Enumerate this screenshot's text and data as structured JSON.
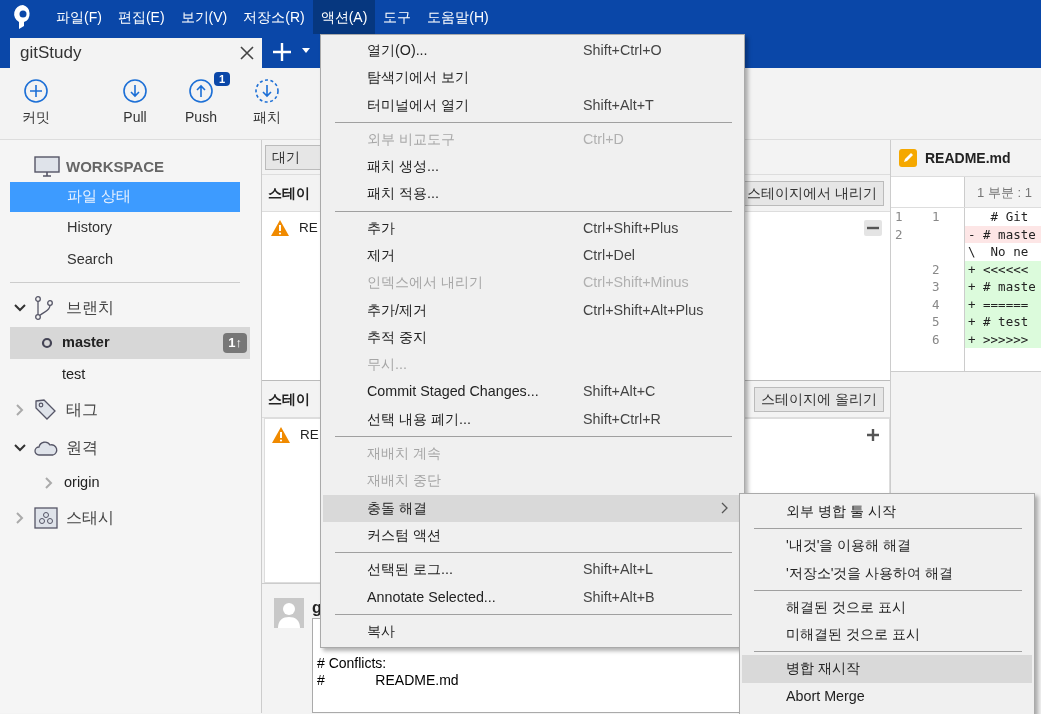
{
  "menubar": [
    {
      "label": "파일(F)",
      "selected": false
    },
    {
      "label": "편집(E)",
      "selected": false
    },
    {
      "label": "보기(V)",
      "selected": false
    },
    {
      "label": "저장소(R)",
      "selected": false
    },
    {
      "label": "액션(A)",
      "selected": true
    },
    {
      "label": "도구",
      "selected": false
    },
    {
      "label": "도움말(H)",
      "selected": false
    }
  ],
  "tabs": [
    {
      "label": "gitStudy",
      "selected": true
    }
  ],
  "toolbar": [
    {
      "label": "커밋",
      "kind": "commit"
    },
    {
      "label": "Pull",
      "kind": "pull"
    },
    {
      "label": "Push",
      "kind": "push",
      "badge": "1"
    },
    {
      "label": "패치",
      "kind": "patch"
    }
  ],
  "sidebar": {
    "workspace": {
      "title": "WORKSPACE",
      "items": [
        {
          "label": "파일 상태",
          "selected": true
        },
        {
          "label": "History",
          "selected": false
        },
        {
          "label": "Search",
          "selected": false
        }
      ]
    },
    "groups": [
      {
        "label": "브랜치",
        "kind": "branch",
        "expanded": true,
        "children": [
          {
            "label": "master",
            "current": true,
            "selected": true,
            "badge": "1↑"
          },
          {
            "label": "test",
            "current": false,
            "selected": false
          }
        ]
      },
      {
        "label": "태그",
        "kind": "tag",
        "expanded": false
      },
      {
        "label": "원격",
        "kind": "remote",
        "expanded": true,
        "children": [
          {
            "label": "origin",
            "expanded": false,
            "selected": false
          }
        ]
      },
      {
        "label": "스태시",
        "kind": "stash",
        "expanded": false
      }
    ]
  },
  "files": {
    "pending_button": "대기",
    "staged": {
      "title": "스테이",
      "button": "스테이지에서 내리기",
      "rows": [
        {
          "name": "RE"
        }
      ]
    },
    "unstaged": {
      "title": "스테이",
      "button": "스테이지에 올리기",
      "rows": [
        {
          "name": "RE"
        }
      ]
    }
  },
  "commit": {
    "author": "g",
    "message": "# Conflicts:\n#\tREADME.md"
  },
  "diff": {
    "file": "README.md",
    "hunk": "1 부분 : 1",
    "lines": [
      {
        "old": "1",
        "new": "1",
        "text": "   # Git",
        "kind": "context"
      },
      {
        "old": "2",
        "text": "- # maste",
        "kind": "removed"
      },
      {
        "text": "\\  No ne",
        "kind": "context"
      },
      {
        "new": "2",
        "text": "+ <<<<<<",
        "kind": "added"
      },
      {
        "new": "3",
        "text": "+ # maste",
        "kind": "added"
      },
      {
        "new": "4",
        "text": "+ ======",
        "kind": "added"
      },
      {
        "new": "5",
        "text": "+ # test",
        "kind": "added"
      },
      {
        "new": "6",
        "text": "+ >>>>>>",
        "kind": "added"
      }
    ]
  },
  "action_menu": [
    {
      "kind": "item",
      "label": "열기(O)...",
      "shortcut": "Shift+Ctrl+O",
      "disabled": false,
      "selected": false
    },
    {
      "kind": "item",
      "label": "탐색기에서 보기",
      "disabled": false,
      "selected": false
    },
    {
      "kind": "item",
      "label": "터미널에서 열기",
      "shortcut": "Shift+Alt+T",
      "disabled": false,
      "selected": false
    },
    {
      "kind": "separator"
    },
    {
      "kind": "item",
      "label": "외부 비교도구",
      "shortcut": "Ctrl+D",
      "disabled": true,
      "selected": false
    },
    {
      "kind": "item",
      "label": "패치 생성...",
      "disabled": false,
      "selected": false
    },
    {
      "kind": "item",
      "label": "패치 적용...",
      "disabled": false,
      "selected": false
    },
    {
      "kind": "separator"
    },
    {
      "kind": "item",
      "label": "추가",
      "shortcut": "Ctrl+Shift+Plus",
      "disabled": false,
      "selected": false
    },
    {
      "kind": "item",
      "label": "제거",
      "shortcut": "Ctrl+Del",
      "disabled": false,
      "selected": false
    },
    {
      "kind": "item",
      "label": "인덱스에서 내리기",
      "shortcut": "Ctrl+Shift+Minus",
      "disabled": true,
      "selected": false
    },
    {
      "kind": "item",
      "label": "추가/제거",
      "shortcut": "Ctrl+Shift+Alt+Plus",
      "disabled": false,
      "selected": false
    },
    {
      "kind": "item",
      "label": "추적 중지",
      "disabled": false,
      "selected": false
    },
    {
      "kind": "item",
      "label": "무시...",
      "disabled": true,
      "selected": false
    },
    {
      "kind": "item",
      "label": "Commit Staged Changes...",
      "shortcut": "Shift+Alt+C",
      "disabled": false,
      "selected": false
    },
    {
      "kind": "item",
      "label": "선택 내용 폐기...",
      "shortcut": "Shift+Ctrl+R",
      "disabled": false,
      "selected": false
    },
    {
      "kind": "separator"
    },
    {
      "kind": "item",
      "label": "재배치 계속",
      "disabled": true,
      "selected": false
    },
    {
      "kind": "item",
      "label": "재배치 중단",
      "disabled": true,
      "selected": false
    },
    {
      "kind": "item",
      "label": "충돌 해결",
      "submenu": true,
      "disabled": false,
      "selected": true
    },
    {
      "kind": "item",
      "label": "커스텀 액션",
      "disabled": false,
      "selected": false
    },
    {
      "kind": "separator"
    },
    {
      "kind": "item",
      "label": "선택된 로그...",
      "shortcut": "Shift+Alt+L",
      "disabled": false,
      "selected": false
    },
    {
      "kind": "item",
      "label": "Annotate Selected...",
      "shortcut": "Shift+Alt+B",
      "disabled": false,
      "selected": false
    },
    {
      "kind": "separator"
    },
    {
      "kind": "item",
      "label": "복사",
      "disabled": false,
      "selected": false
    }
  ],
  "conflict_submenu": [
    {
      "kind": "item",
      "label": "외부 병합 툴 시작",
      "disabled": false,
      "selected": false
    },
    {
      "kind": "separator"
    },
    {
      "kind": "item",
      "label": "'내것'을 이용해 해결",
      "disabled": false,
      "selected": false
    },
    {
      "kind": "item",
      "label": "'저장소'것을 사용하여 해결",
      "disabled": false,
      "selected": false
    },
    {
      "kind": "separator"
    },
    {
      "kind": "item",
      "label": "해결된 것으로 표시",
      "disabled": false,
      "selected": false
    },
    {
      "kind": "item",
      "label": "미해결된 것으로 표시",
      "disabled": false,
      "selected": false
    },
    {
      "kind": "separator"
    },
    {
      "kind": "item",
      "label": "병합 재시작",
      "disabled": false,
      "selected": true
    },
    {
      "kind": "item",
      "label": "Abort Merge",
      "disabled": false,
      "selected": false
    }
  ]
}
